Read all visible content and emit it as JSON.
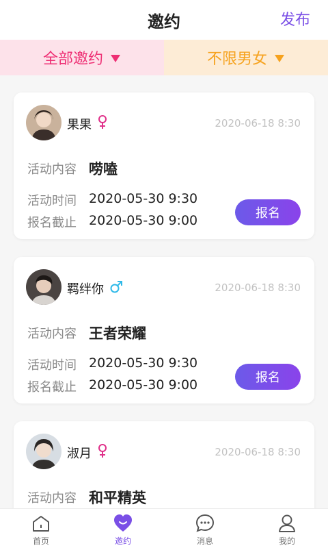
{
  "header": {
    "title": "邀约",
    "publish_label": "发布"
  },
  "filters": {
    "all_label": "全部邀约",
    "gender_label": "不限男女",
    "colors": {
      "all": "#ee2f74",
      "gender": "#f6a21e"
    }
  },
  "labels": {
    "content": "活动内容",
    "activity_time": "活动时间",
    "deadline": "报名截止",
    "signup": "报名"
  },
  "cards": [
    {
      "name": "果果",
      "gender": "female",
      "posted": "2020-06-18 8:30",
      "content": "唠嗑",
      "activity_time": "2020-05-30   9:30",
      "deadline": "2020-05-30   9:00"
    },
    {
      "name": "羁绊你",
      "gender": "male",
      "posted": "2020-06-18 8:30",
      "content": "王者荣耀",
      "activity_time": "2020-05-30   9:30",
      "deadline": "2020-05-30   9:00"
    },
    {
      "name": "淑月",
      "gender": "female",
      "posted": "2020-06-18 8:30",
      "content": "和平精英"
    }
  ],
  "tabs": [
    {
      "label": "首页",
      "icon": "home-icon"
    },
    {
      "label": "邀约",
      "icon": "heart-chat-icon"
    },
    {
      "label": "消息",
      "icon": "message-icon"
    },
    {
      "label": "我的",
      "icon": "user-icon"
    }
  ],
  "colors": {
    "accent": "#7a4fe6",
    "female": "#e0318a",
    "male": "#2fb9e8"
  }
}
